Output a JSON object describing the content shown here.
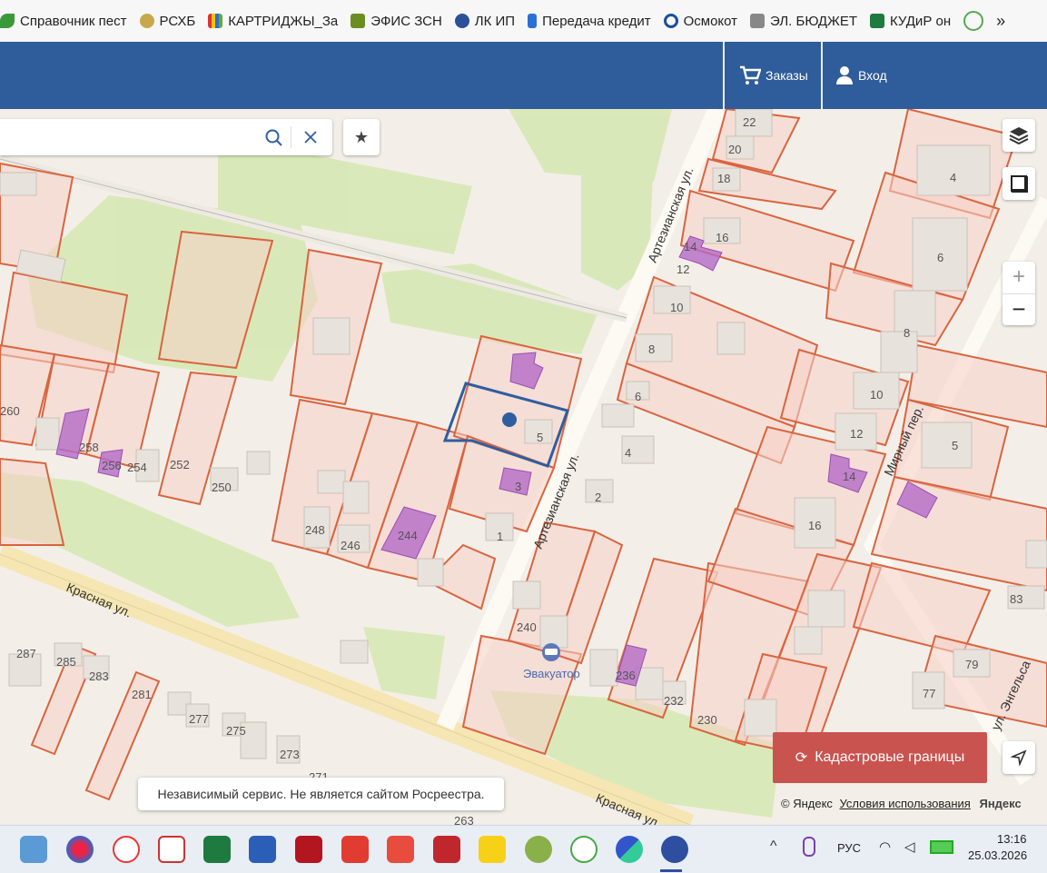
{
  "bookmarks": [
    {
      "label": "Справочник пест",
      "icon": "leaf-icon",
      "color": "#3a9a3a"
    },
    {
      "label": "РСХБ",
      "icon": "rshb-icon",
      "color": "#c8a84a"
    },
    {
      "label": "КАРТРИДЖЫ_За",
      "icon": "bars-icon",
      "color": "#d33"
    },
    {
      "label": "ЭФИС ЗСН",
      "icon": "stack-icon",
      "color": "#6b8e23"
    },
    {
      "label": "ЛК ИП",
      "icon": "emblem-icon",
      "color": "#2d4f9a"
    },
    {
      "label": "Передача кредит",
      "icon": "y-icon",
      "color": "#2a6fd6"
    },
    {
      "label": "Осмокот",
      "icon": "refresh-icon",
      "color": "#1a4fa0"
    },
    {
      "label": "ЭЛ. БЮДЖЕТ",
      "icon": "building-icon",
      "color": "#888"
    },
    {
      "label": "КУДиР он",
      "icon": "excel-icon",
      "color": "#1e7a3e"
    }
  ],
  "header": {
    "orders": "Заказы",
    "login": "Вход"
  },
  "map_labels": [
    "22",
    "20",
    "18",
    "16",
    "14",
    "12",
    "4",
    "6",
    "8",
    "10",
    "8",
    "10",
    "12",
    "14",
    "16",
    "6",
    "4",
    "2",
    "5",
    "3",
    "1",
    "244",
    "246",
    "248",
    "250",
    "252",
    "254",
    "256",
    "258",
    "260",
    "240",
    "236",
    "232",
    "230",
    "83",
    "79",
    "77",
    "5",
    "287",
    "285",
    "283",
    "281",
    "277",
    "275",
    "273",
    "271",
    "263"
  ],
  "streets": {
    "krasnaya1": "Красная ул.",
    "krasnaya2": "Красная ул.",
    "artez1": "Артезианская ул.",
    "artez2": "Артезианская ул.",
    "mirny": "Мирный пер.",
    "engels": "ул. Энгельса"
  },
  "poi": {
    "evacuator": "Эвакуатор"
  },
  "notice": "Независимый сервис. Не является сайтом Росреестра.",
  "cadastral_button": "Кадастровые границы",
  "copyright": {
    "brand": "© Яндекс",
    "terms": "Условия использования",
    "logo": "Яндекс"
  },
  "taskbar": {
    "lang": "РУС",
    "time": "13:16",
    "date": "25.03.2026"
  }
}
